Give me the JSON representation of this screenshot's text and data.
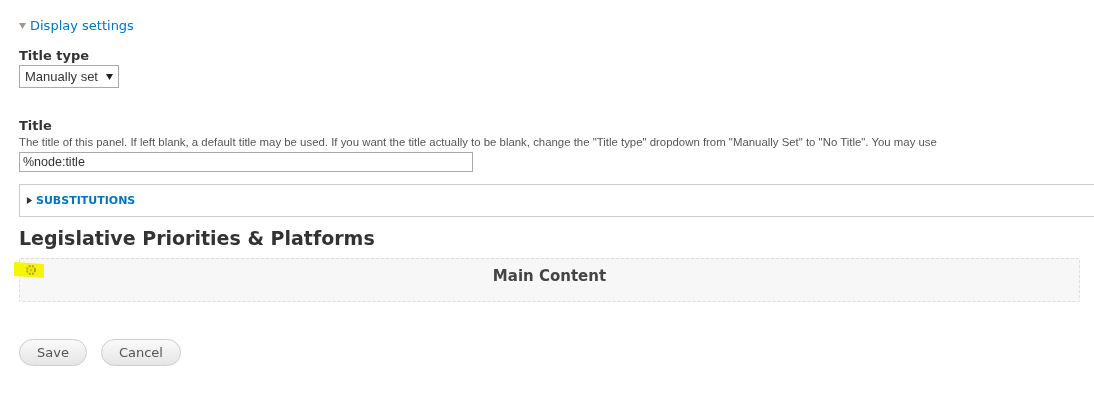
{
  "display_settings": {
    "label": "Display settings",
    "expanded": true
  },
  "title_type": {
    "label": "Title type",
    "value": "Manually set"
  },
  "title": {
    "label": "Title",
    "description": "The title of this panel. If left blank, a default title may be used. If you want the title actually to be blank, change the \"Title type\" dropdown from \"Manually Set\" to \"No Title\". You may use",
    "value": "%node:title"
  },
  "substitutions": {
    "label": "SUBSTITUTIONS",
    "expanded": false
  },
  "layout": {
    "heading": "Legislative Priorities & Platforms",
    "regions": [
      {
        "label": "Main Content",
        "highlighted": true
      }
    ]
  },
  "buttons": [
    {
      "label": "Save"
    },
    {
      "label": "Cancel"
    }
  ]
}
